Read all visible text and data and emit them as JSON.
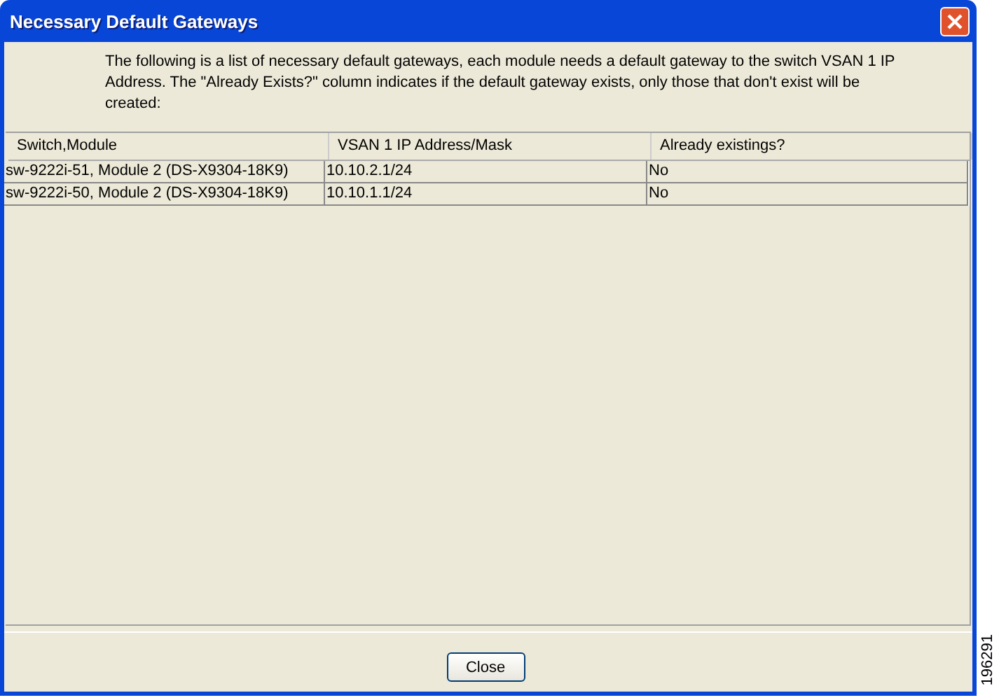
{
  "window": {
    "title": "Necessary Default Gateways"
  },
  "message": "The following is a list of necessary default gateways, each module needs a default gateway to the switch VSAN 1 IP Address.  The \"Already Exists?\" column indicates if the default gateway exists, only those that don't exist will be created:",
  "table": {
    "columns": [
      "Switch,Module",
      "VSAN 1 IP Address/Mask",
      "Already existings?"
    ],
    "rows": [
      [
        "sw-9222i-51, Module 2 (DS-X9304-18K9)",
        "10.10.2.1/24",
        "No"
      ],
      [
        "sw-9222i-50, Module 2 (DS-X9304-18K9)",
        "10.10.1.1/24",
        "No"
      ]
    ]
  },
  "buttons": [
    "Close"
  ],
  "figure_id": "196291"
}
